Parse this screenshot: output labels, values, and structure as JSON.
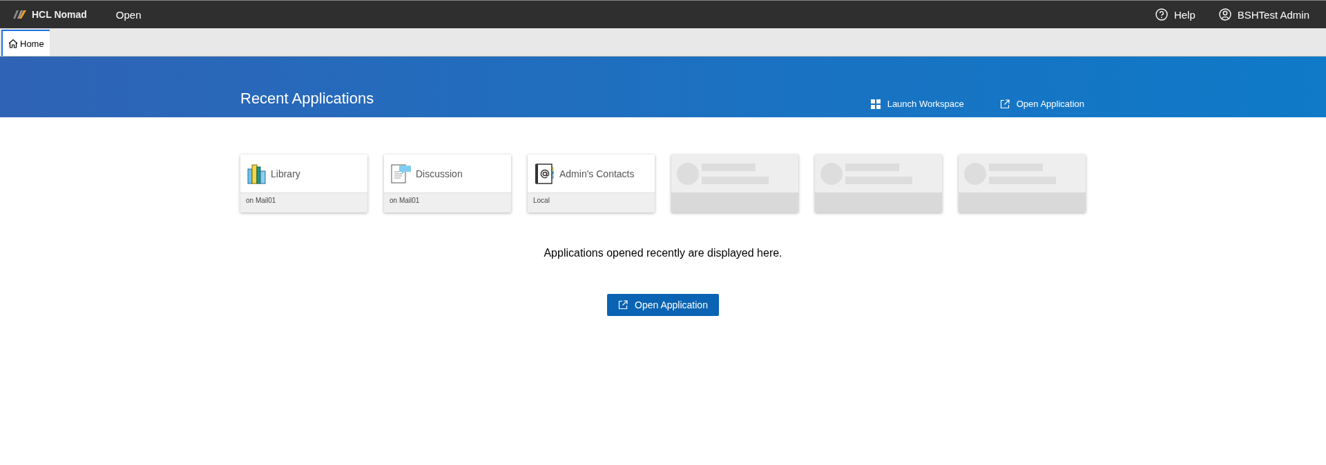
{
  "topbar": {
    "brand": "HCL Nomad",
    "menu": "Open",
    "help": "Help",
    "user": "BSHTest Admin"
  },
  "tabs": [
    {
      "label": "Home",
      "selected": true
    }
  ],
  "banner": {
    "title": "Recent Applications",
    "actions": [
      {
        "kind": "workspace",
        "label": "Launch Workspace"
      },
      {
        "kind": "open",
        "label": "Open Application"
      }
    ]
  },
  "cards": [
    {
      "kind": "library",
      "title": "Library",
      "location": "on Mail01"
    },
    {
      "kind": "discussion",
      "title": "Discussion",
      "location": "on Mail01"
    },
    {
      "kind": "contacts",
      "title": "Admin's Contacts",
      "location": "Local"
    },
    {
      "kind": "placeholder"
    },
    {
      "kind": "placeholder"
    },
    {
      "kind": "placeholder"
    }
  ],
  "message": "Applications opened recently are displayed here.",
  "open_button": "Open Application"
}
